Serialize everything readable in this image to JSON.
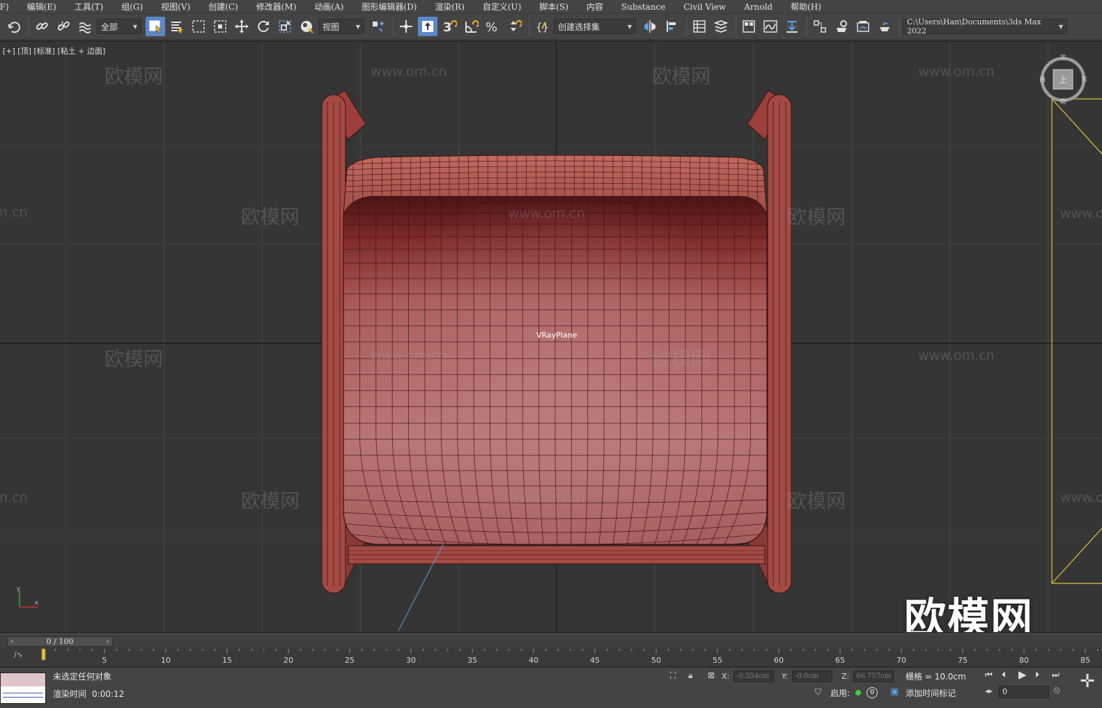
{
  "menu": [
    "(F)",
    "编辑(E)",
    "工具(T)",
    "组(G)",
    "视图(V)",
    "创建(C)",
    "修改器(M)",
    "动画(A)",
    "图形编辑器(D)",
    "渲染(R)",
    "自定义(U)",
    "脚本(S)",
    "内容",
    "Substance",
    "Civil View",
    "Arnold",
    "帮助(H)"
  ],
  "toolbar": {
    "selection_filter": "全部",
    "ref_coord": "视图",
    "named_selection": "创建选择集",
    "project_path": "C:\\Users\\Han\\Documents\\3ds Max 2022",
    "icons": [
      "undo-icon",
      "link-icon",
      "unlink-icon",
      "bind-space-warp-icon",
      "select-object-icon",
      "select-by-name-icon",
      "rect-region-icon",
      "window-crossing-icon",
      "move-icon",
      "rotate-icon",
      "scale-icon",
      "placement-icon",
      "pivot-icon",
      "snap-3d-icon",
      "angle-snap-icon",
      "percent-snap-icon",
      "spinner-snap-icon",
      "edit-named-sets-icon",
      "mirror-icon",
      "align-icon",
      "layer-explorer-icon",
      "scene-explorer-icon",
      "ribbon-icon",
      "curve-editor-icon",
      "schematic-icon",
      "material-editor-icon",
      "render-setup-icon",
      "rendered-frame-icon",
      "render-icon"
    ]
  },
  "viewport": {
    "label": "[+] [顶] [标准] [粘土 + 边面]",
    "object_label": "VRayPlane",
    "watermark": "欧模网",
    "watermark_url": "www.om.cn",
    "viewcube": {
      "north": "北",
      "south": "南",
      "east": "东",
      "west": "西",
      "face": "上"
    },
    "colors": {
      "background": "#353535",
      "chair": "#b96a6a",
      "grid": "#404040",
      "axis": "#111111",
      "camera": "#e3c63a"
    }
  },
  "timeline": {
    "frame_display": "0 / 100",
    "ticks": [
      "5",
      "10",
      "15",
      "20",
      "25",
      "30",
      "35",
      "40",
      "45",
      "50",
      "55",
      "60",
      "65",
      "70",
      "75",
      "80",
      "85"
    ]
  },
  "status": {
    "selection_text": "未选定任何对象",
    "render_time_label": "渲染时间",
    "render_time_value": "0:00:12",
    "x_label": "X:",
    "x_value": "-0.554cm",
    "y_label": "Y:",
    "y_value": "-0.0cm",
    "z_label": "Z:",
    "z_value": "66.757cm",
    "grid_text": "栅格 = 10.0cm",
    "enable_label": "启用:",
    "enable_count": "0",
    "add_time_tag": "添加时间标记",
    "frame_field": "0"
  }
}
